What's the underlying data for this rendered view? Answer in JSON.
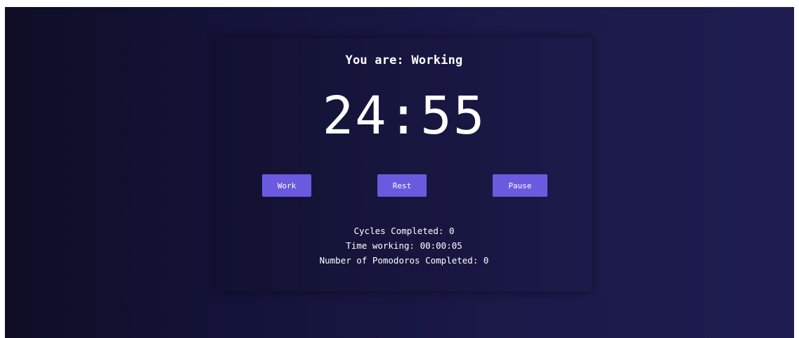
{
  "status": {
    "label": "You are:",
    "state": "Working"
  },
  "timer": {
    "display": "24:55"
  },
  "buttons": {
    "work": "Work",
    "rest": "Rest",
    "pause": "Pause"
  },
  "stats": {
    "cycles_label": "Cycles Completed:",
    "cycles_value": "0",
    "time_label": "Time working:",
    "time_value": "00:00:05",
    "pomodoros_label": "Number of Pomodoros Completed:",
    "pomodoros_value": "0"
  },
  "colors": {
    "accent": "#6a5ae0",
    "background": "#16153f",
    "text": "#ffffff"
  }
}
